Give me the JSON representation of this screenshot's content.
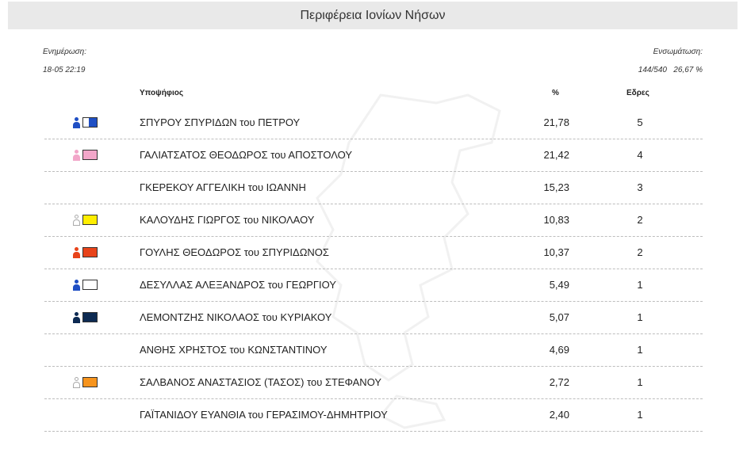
{
  "header": {
    "title": "Περιφέρεια Ιονίων Νήσων"
  },
  "update": {
    "label": "Ενημέρωση:",
    "value": "18-05 22:19"
  },
  "integration": {
    "label": "Ενσωμάτωση:",
    "stations": "144/540",
    "percent": "26,67 %"
  },
  "columns": {
    "candidate": "Υποψήφιος",
    "percent": "%",
    "seats": "Εδρες"
  },
  "candidates": [
    {
      "name": "ΣΠΥΡΟΥ ΣΠΥΡΙΔΩΝ του ΠΕΤΡΟΥ",
      "percent": "21,78",
      "seats": "5",
      "icon": "person-icon",
      "person_color": "#1f4fc4",
      "swatch_color": "#1f4fc4",
      "swatch_style": "half-blue"
    },
    {
      "name": "ΓΑΛΙΑΤΣΑΤΟΣ ΘΕΟΔΩΡΟΣ του ΑΠΟΣΤΟΛΟΥ",
      "percent": "21,42",
      "seats": "4",
      "icon": "person-icon",
      "person_color": "#f2a6c9",
      "swatch_color": "#f2a6c9"
    },
    {
      "name": "ΓΚΕΡΕΚΟΥ ΑΓΓΕΛΙΚΗ του ΙΩΑΝΝΗ",
      "percent": "15,23",
      "seats": "3"
    },
    {
      "name": "ΚΑΛΟΥΔΗΣ ΓΙΩΡΓΟΣ του ΝΙΚΟΛΑΟΥ",
      "percent": "10,83",
      "seats": "2",
      "icon": "person-outline-icon",
      "person_color": "#ffffff",
      "swatch_color": "#ffee00"
    },
    {
      "name": "ΓΟΥΛΗΣ ΘΕΟΔΩΡΟΣ του ΣΠΥΡΙΔΩΝΟΣ",
      "percent": "10,37",
      "seats": "2",
      "icon": "person-icon",
      "person_color": "#e8431a",
      "swatch_color": "#e8431a"
    },
    {
      "name": "ΔΕΣΥΛΛΑΣ ΑΛΕΞΑΝΔΡΟΣ του ΓΕΩΡΓΙΟΥ",
      "percent": "5,49",
      "seats": "1",
      "icon": "person-icon",
      "person_color": "#1f4fc4",
      "swatch_color": "#ffffff"
    },
    {
      "name": "ΛΕΜΟΝΤΖΗΣ ΝΙΚΟΛΑΟΣ του ΚΥΡΙΑΚΟΥ",
      "percent": "5,07",
      "seats": "1",
      "icon": "person-icon",
      "person_color": "#0d2a52",
      "swatch_color": "#0d2a52"
    },
    {
      "name": "ΑΝΘΗΣ ΧΡΗΣΤΟΣ του ΚΩΝΣΤΑΝΤΙΝΟΥ",
      "percent": "4,69",
      "seats": "1"
    },
    {
      "name": "ΣΑΛΒΑΝΟΣ ΑΝΑΣΤΑΣΙΟΣ (ΤΑΣΟΣ) του ΣΤΕΦΑΝΟΥ",
      "percent": "2,72",
      "seats": "1",
      "icon": "person-outline-icon",
      "person_color": "#ffffff",
      "swatch_color": "#f7941d"
    },
    {
      "name": "ΓΑΪΤΑΝΙΔΟΥ ΕΥΑΝΘΙΑ του ΓΕΡΑΣΙΜΟΥ-ΔΗΜΗΤΡΙΟΥ",
      "percent": "2,40",
      "seats": "1"
    }
  ]
}
